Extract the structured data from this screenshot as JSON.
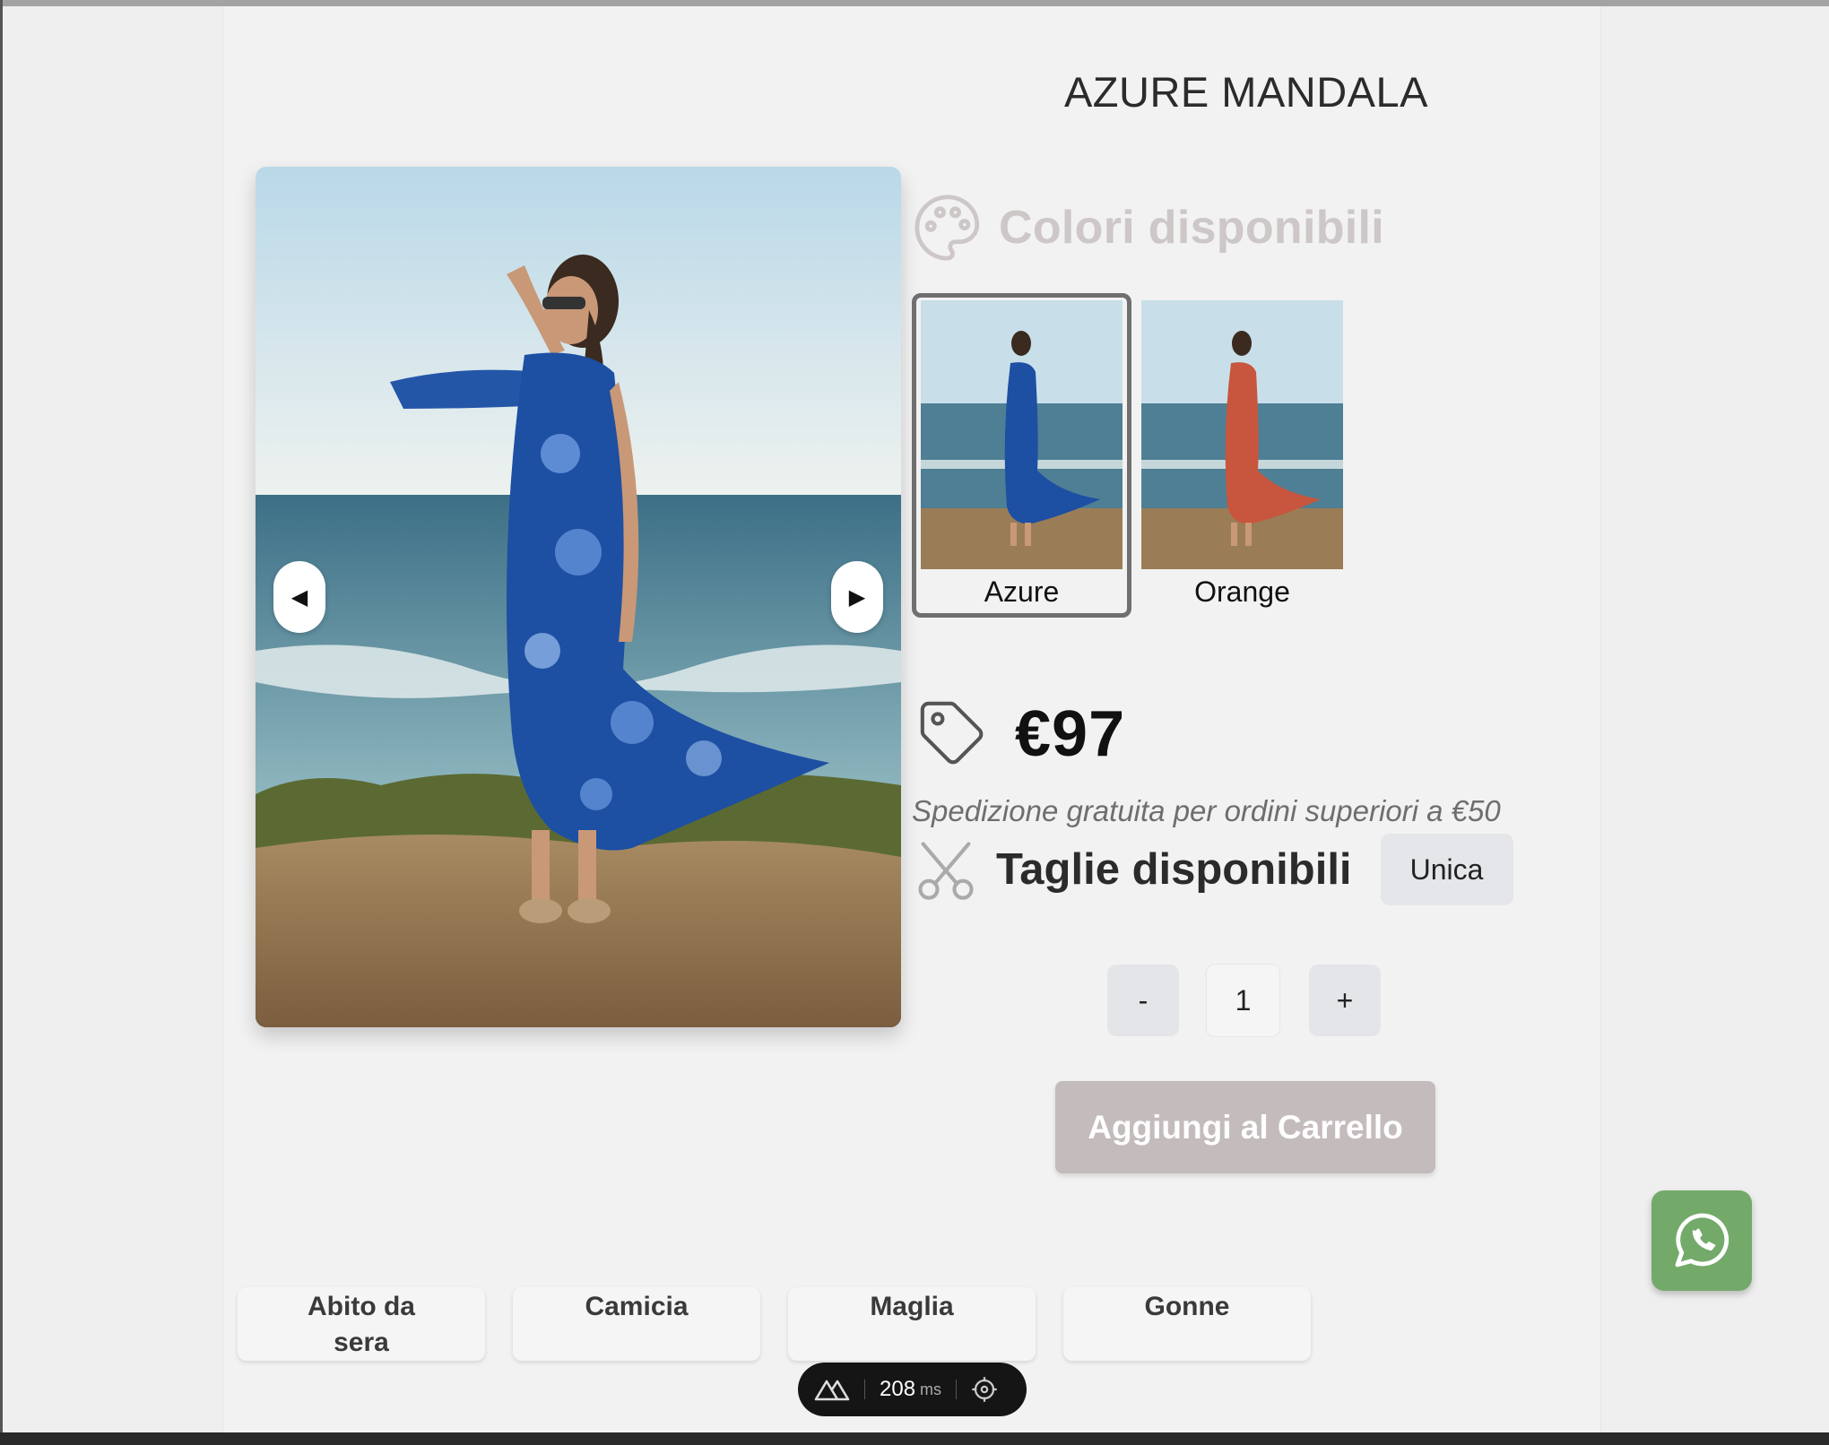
{
  "product": {
    "title": "AZURE MANDALA",
    "colors_heading": "Colori disponibili",
    "colors": [
      {
        "name": "Azure",
        "selected": true,
        "hex": "#1f4fa0"
      },
      {
        "name": "Orange",
        "selected": false,
        "hex": "#c8553d"
      }
    ],
    "price": "€97",
    "shipping_note": "Spedizione gratuita per ordini superiori a €50",
    "sizes_heading": "Taglie disponibili",
    "sizes": [
      "Unica"
    ],
    "quantity": {
      "minus": "-",
      "value": "1",
      "plus": "+"
    },
    "add_to_cart": "Aggiungi al Carrello"
  },
  "gallery": {
    "prev_icon": "◀",
    "next_icon": "▶"
  },
  "categories": [
    "Abito da sera",
    "Camicia",
    "Maglia",
    "Gonne"
  ],
  "devtools": {
    "ms_value": "208",
    "ms_unit": "ms"
  },
  "colors": {
    "accent_disabled": "#c4bcbc",
    "whatsapp": "#73aa6a",
    "heading_muted": "#cdc7c7"
  }
}
